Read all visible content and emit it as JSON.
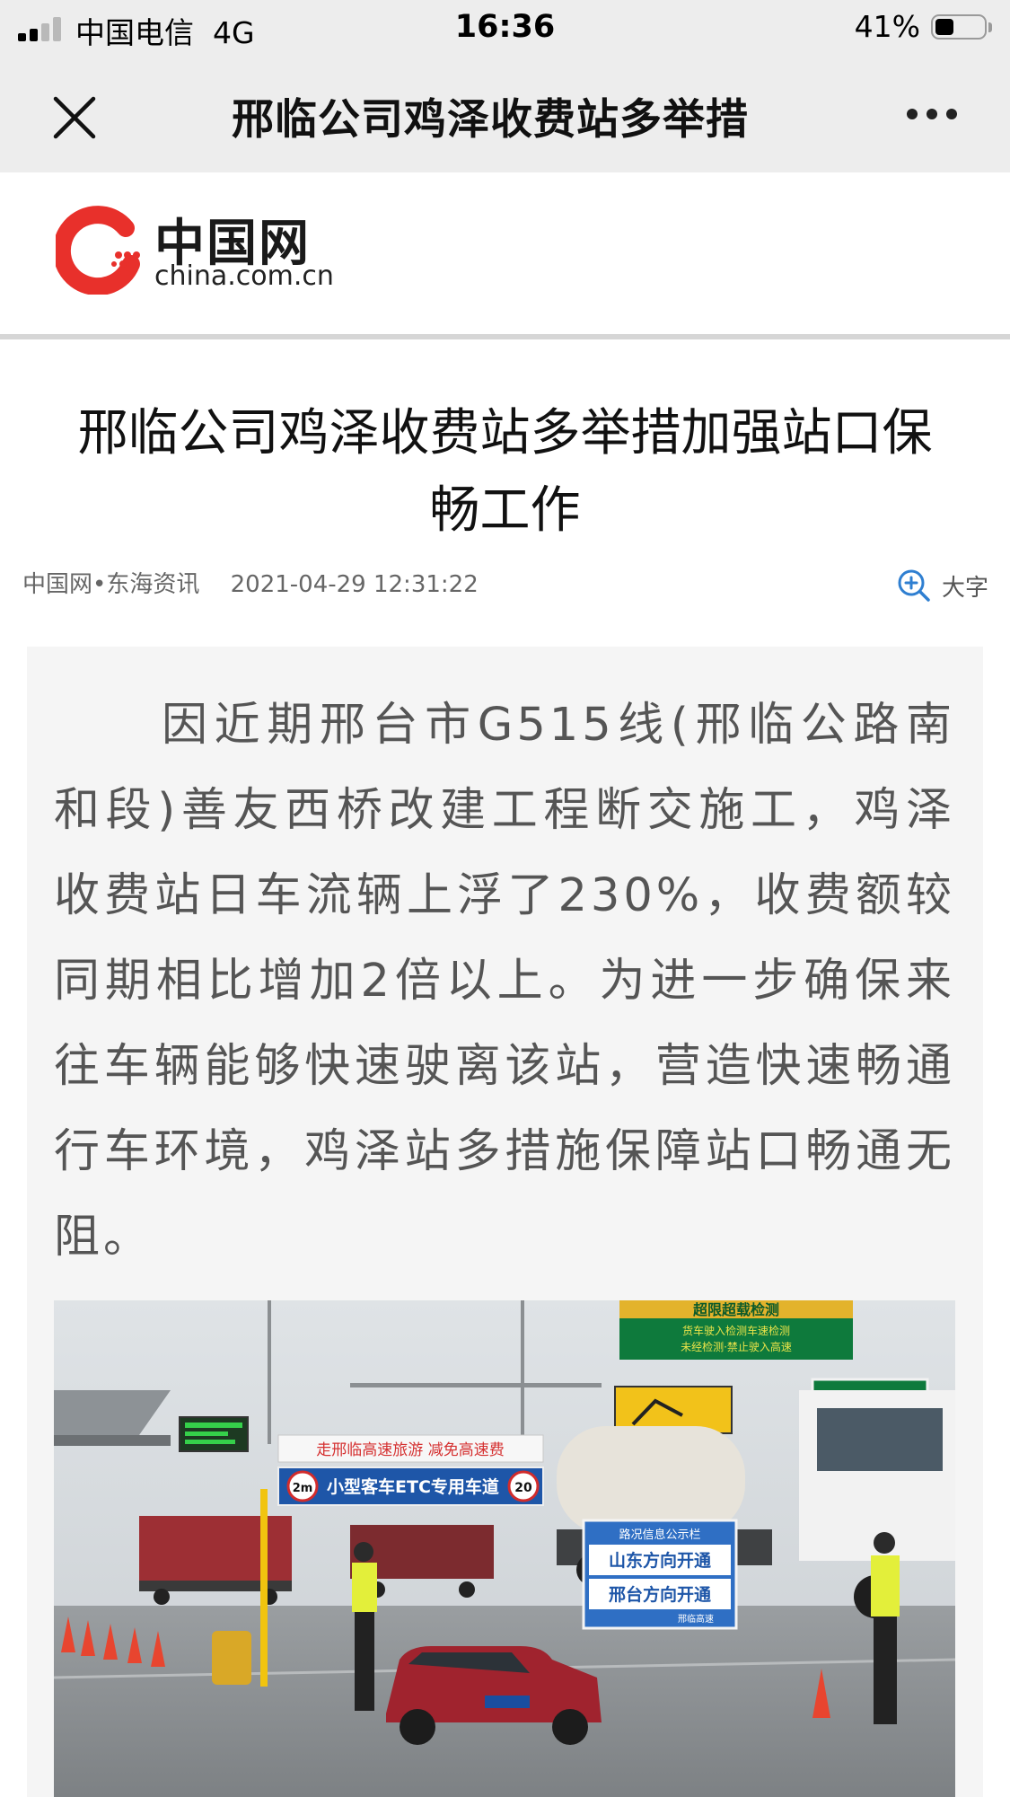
{
  "status_bar": {
    "carrier": "中国电信",
    "network": "4G",
    "time": "16:36",
    "battery_percent": "41%",
    "battery_level": 0.41
  },
  "nav": {
    "close_icon": "close-icon",
    "title": "邢临公司鸡泽收费站多举措",
    "more_icon": "more-icon"
  },
  "brand": {
    "name_cn": "中国网",
    "name_en": "china.com.cn",
    "accent_color": "#e8302b"
  },
  "article": {
    "title": "邢临公司鸡泽收费站多举措加强站口保畅工作",
    "source": "中国网•东海资讯",
    "date": "2021-04-29 12:31:22",
    "font_size_label": "大字",
    "paragraph": "因近期邢台市G515线(邢临公路南和段)善友西桥改建工程断交施工，鸡泽收费站日车流辆上浮了230%，收费额较同期相比增加2倍以上。为进一步确保来往车辆能够快速驶离该站，营造快速畅通行车环境，鸡泽站多措施保障站口畅通无阻。"
  },
  "photo": {
    "sign_overload": "超限超载检测",
    "sign_overload_sub1": "货车驶入检测车速检测",
    "sign_overload_sub2": "未经检测·禁止驶入高速",
    "sign_tourism": "走邢临高速旅游 减免高速费",
    "sign_lane": "小型客车ETC专用车道",
    "sign_height": "2m",
    "sign_speed": "20",
    "board_title": "路况信息公示栏",
    "board_line1": "山东方向开通",
    "board_line2": "邢台方向开通",
    "board_footer": "邢临高速"
  }
}
